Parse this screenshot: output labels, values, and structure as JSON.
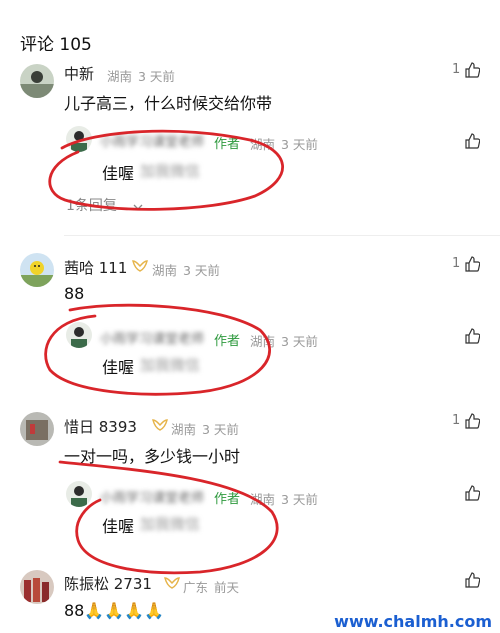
{
  "header": {
    "title": "评论 105"
  },
  "author_tag": "作者",
  "comments": [
    {
      "user": "中新",
      "badge": "",
      "location": "湖南",
      "time": "3 天前",
      "likes": "1",
      "text": "儿子高三，什么时候交给你带",
      "reply": {
        "name": "小雨学习课堂老师",
        "text_prefix": "佳喔",
        "text_blur": "加我微信",
        "location": "湖南",
        "time": "3 天前"
      },
      "more": "1条回复",
      "more_icon": "chevron-down-icon"
    },
    {
      "user": "茜哈 111",
      "badge": "gold-ribbon-icon",
      "location": "湖南",
      "time": "3 天前",
      "likes": "1",
      "text": "88",
      "reply": {
        "name": "小雨学习课堂老师",
        "text_prefix": "佳喔",
        "text_blur": "加我微信",
        "location": "湖南",
        "time": "3 天前"
      }
    },
    {
      "user": "惜日 8393",
      "badge": "gold-ribbon-icon",
      "location": "湖南",
      "time": "3 天前",
      "likes": "1",
      "text": "一对一吗，多少钱一小时",
      "reply": {
        "name": "小雨学习课堂老师",
        "text_prefix": "佳喔",
        "text_blur": "加我微信",
        "location": "湖南",
        "time": "3 天前"
      }
    },
    {
      "user": "陈振松 2731",
      "badge": "gold-ribbon-icon",
      "location": "广东",
      "time": "前天",
      "likes": "",
      "text": "88🙏🙏🙏🙏"
    }
  ],
  "watermark": "www.chalmh.com",
  "colors": {
    "author_green": "#2f9a3f",
    "annotation_red": "#d9252a",
    "watermark_blue": "#1b5fd1"
  }
}
